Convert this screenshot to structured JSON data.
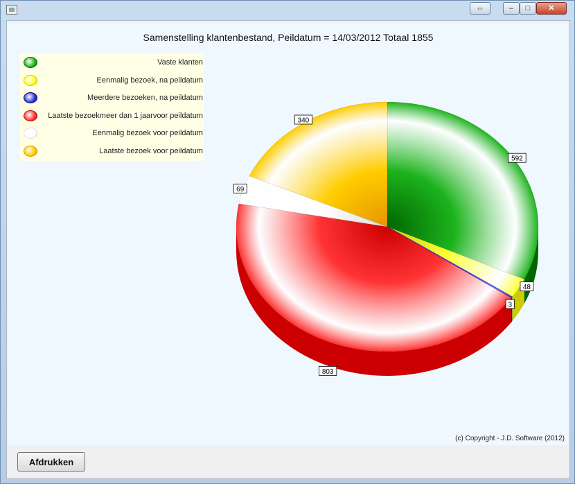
{
  "window": {
    "title": ""
  },
  "chart_data": {
    "type": "pie",
    "title": "Samenstelling klantenbestand, Peildatum = 14/03/2012 Totaal 1855",
    "total": 1855,
    "categories": [
      "Vaste klanten",
      "Eenmalig bezoek, na peildatum",
      "Meerdere bezoeken, na peildatum",
      "Laatste bezoekmeer dan 1 jaarvoor peildatum",
      "Eenmalig bezoek voor peildatum",
      "Laatste bezoek voor peildatum"
    ],
    "values": [
      592,
      48,
      3,
      803,
      69,
      340
    ],
    "colors": [
      "#1db31d",
      "#ffff33",
      "#3333cc",
      "#ff3333",
      "#ffffff",
      "#ffcc00"
    ],
    "side_colors": [
      "#006600",
      "#cccc00",
      "#000099",
      "#cc0000",
      "#dddddd",
      "#e69500"
    ],
    "legend_placement": "top-left"
  },
  "footer": {
    "copyright": "(c) Copyright - J.D. Software (2012)"
  },
  "buttons": {
    "print_label": "Afdrukken"
  }
}
